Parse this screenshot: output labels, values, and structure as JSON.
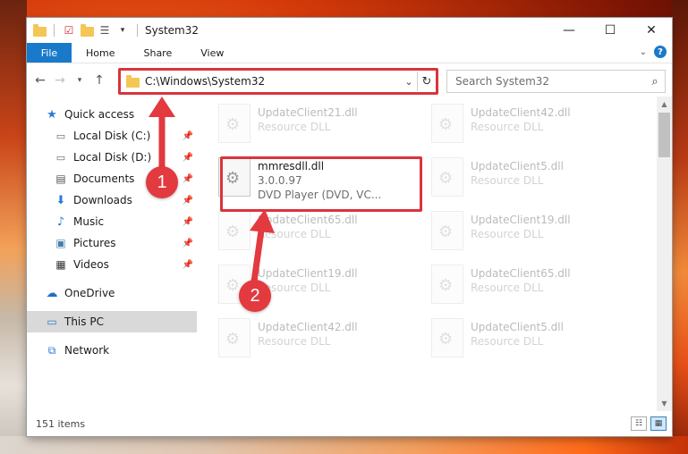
{
  "window": {
    "title": "System32"
  },
  "window_controls": {
    "minimize": "—",
    "maximize": "☐",
    "close": "✕"
  },
  "ribbon": {
    "tabs": [
      {
        "label": "File"
      },
      {
        "label": "Home"
      },
      {
        "label": "Share"
      },
      {
        "label": "View"
      }
    ]
  },
  "nav": {
    "address": "C:\\Windows\\System32",
    "search_placeholder": "Search System32"
  },
  "sidebar": {
    "items": [
      {
        "label": "Quick access",
        "icon": "star-icon"
      },
      {
        "label": "Local Disk (C:)",
        "icon": "drive-icon",
        "pinned": true
      },
      {
        "label": "Local Disk (D:)",
        "icon": "drive-icon",
        "pinned": true
      },
      {
        "label": "Documents",
        "icon": "documents-icon",
        "pinned": true
      },
      {
        "label": "Downloads",
        "icon": "download-icon",
        "pinned": true
      },
      {
        "label": "Music",
        "icon": "music-icon",
        "pinned": true
      },
      {
        "label": "Pictures",
        "icon": "pictures-icon",
        "pinned": true
      },
      {
        "label": "Videos",
        "icon": "videos-icon",
        "pinned": true
      },
      {
        "label": "OneDrive",
        "icon": "cloud-icon"
      },
      {
        "label": "This PC",
        "icon": "computer-icon"
      },
      {
        "label": "Network",
        "icon": "network-icon"
      }
    ]
  },
  "files": [
    {
      "name": "UpdateClient21.dll",
      "sub1": "Resource DLL",
      "sub2": ""
    },
    {
      "name": "UpdateClient42.dll",
      "sub1": "Resource DLL",
      "sub2": ""
    },
    {
      "name": "mmresdll.dll",
      "sub1": "3.0.0.97",
      "sub2": "DVD Player (DVD, VC..."
    },
    {
      "name": "UpdateClient5.dll",
      "sub1": "Resource DLL",
      "sub2": ""
    },
    {
      "name": "UpdateClient65.dll",
      "sub1": "Resource DLL",
      "sub2": ""
    },
    {
      "name": "UpdateClient19.dll",
      "sub1": "Resource DLL",
      "sub2": ""
    },
    {
      "name": "UpdateClient19.dll",
      "sub1": "Resource DLL",
      "sub2": ""
    },
    {
      "name": "UpdateClient65.dll",
      "sub1": "Resource DLL",
      "sub2": ""
    },
    {
      "name": "UpdateClient42.dll",
      "sub1": "Resource DLL",
      "sub2": ""
    },
    {
      "name": "UpdateClient5.dll",
      "sub1": "Resource DLL",
      "sub2": ""
    }
  ],
  "status": {
    "item_count": "151 items"
  },
  "annotations": {
    "step1": "1",
    "step2": "2",
    "color": "#e23a3f"
  }
}
